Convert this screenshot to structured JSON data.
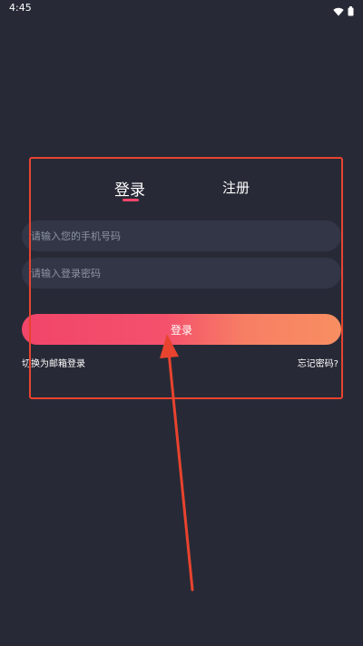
{
  "status_bar": {
    "time": "4:45",
    "icons": [
      "wifi-icon",
      "battery-icon"
    ]
  },
  "tabs": {
    "login": "登录",
    "register": "注册"
  },
  "inputs": {
    "phone_placeholder": "请输入您的手机号码",
    "password_placeholder": "请输入登录密码"
  },
  "login_button_label": "登录",
  "links": {
    "email_login": "切换为邮箱登录",
    "forgot_password": "忘记密码?"
  },
  "colors": {
    "background": "#272a36",
    "input_background": "#323646",
    "accent_pink": "#f3476a",
    "accent_orange": "#f88e62",
    "annotation_red": "#e8432e"
  }
}
